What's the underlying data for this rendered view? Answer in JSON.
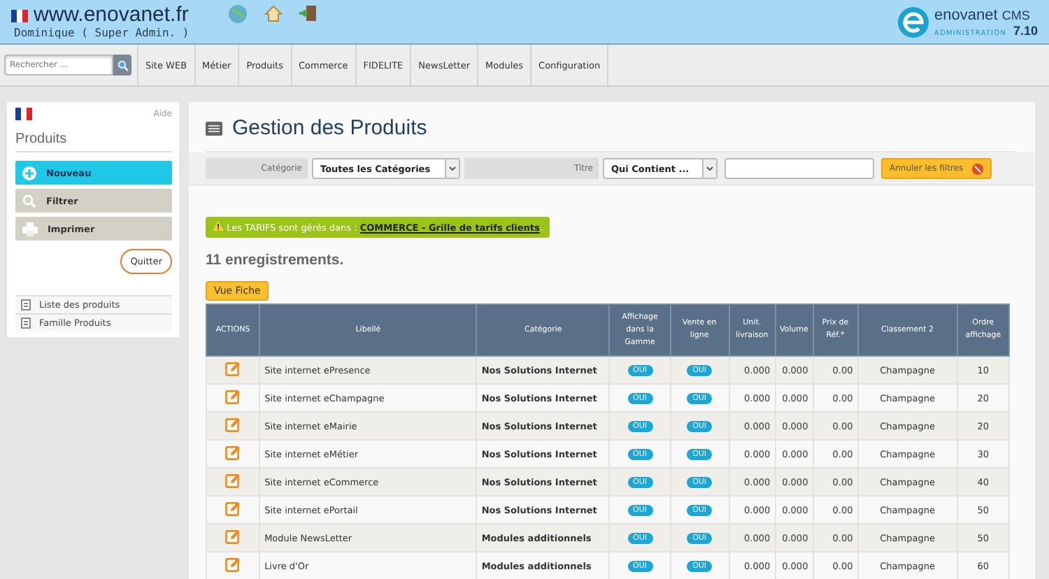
{
  "header": {
    "site": "www.enovanet.fr",
    "user": "Dominique ( Super Admin. )",
    "brand": "enovanet",
    "brand_suffix": "CMS",
    "brand_sub": "ADMINISTRATION",
    "version": "7.10"
  },
  "search": {
    "placeholder": "Rechercher ..."
  },
  "menu": [
    "Site WEB",
    "Métier",
    "Produits",
    "Commerce",
    "FIDELITE",
    "NewsLetter",
    "Modules",
    "Configuration"
  ],
  "sidebar": {
    "help": "Aide",
    "title": "Produits",
    "actions": [
      {
        "label": "Nouveau",
        "kind": "new"
      },
      {
        "label": "Filtrer",
        "kind": "filter"
      },
      {
        "label": "Imprimer",
        "kind": "print"
      }
    ],
    "quit": "Quitter",
    "links": [
      "Liste des produits",
      "Famille Produits"
    ]
  },
  "page": {
    "title": "Gestion des Produits",
    "filters": [
      {
        "label": "Catégorie",
        "value": "Toutes les Catégories"
      },
      {
        "label": "Titre",
        "value": "Qui Contient ..."
      }
    ],
    "reset": "Annuler les filtres",
    "notice": {
      "text": "Les TARIFS sont gérés dans :",
      "link": "COMMERCE - Grille de tarifs clients",
      "end": "."
    },
    "count": "11 enregistrements.",
    "view_button": "Vue Fiche",
    "table": {
      "columns": [
        "ACTIONS",
        "Libellé",
        "Catégorie",
        "Affichage dans la Gamme",
        "Vente en ligne",
        "Unit. livraison",
        "Volume",
        "Prix de Réf.*",
        "Classement 2",
        "Ordre affichage"
      ],
      "rows": [
        {
          "label": "Site internet ePresence",
          "category": "Nos Solutions Internet",
          "display": "OUI",
          "online": "OUI",
          "unit": "0.000",
          "volume": "0.000",
          "price": "0.00",
          "rank": "Champagne",
          "order": "10"
        },
        {
          "label": "Site internet eChampagne",
          "category": "Nos Solutions Internet",
          "display": "OUI",
          "online": "OUI",
          "unit": "0.000",
          "volume": "0.000",
          "price": "0.00",
          "rank": "Champagne",
          "order": "20"
        },
        {
          "label": "Site internet eMairie",
          "category": "Nos Solutions Internet",
          "display": "OUI",
          "online": "OUI",
          "unit": "0.000",
          "volume": "0.000",
          "price": "0.00",
          "rank": "Champagne",
          "order": "20"
        },
        {
          "label": "Site internet eMétier",
          "category": "Nos Solutions Internet",
          "display": "OUI",
          "online": "OUI",
          "unit": "0.000",
          "volume": "0.000",
          "price": "0.00",
          "rank": "Champagne",
          "order": "30"
        },
        {
          "label": "Site internet eCommerce",
          "category": "Nos Solutions Internet",
          "display": "OUI",
          "online": "OUI",
          "unit": "0.000",
          "volume": "0.000",
          "price": "0.00",
          "rank": "Champagne",
          "order": "40"
        },
        {
          "label": "Site internet ePortail",
          "category": "Nos Solutions Internet",
          "display": "OUI",
          "online": "OUI",
          "unit": "0.000",
          "volume": "0.000",
          "price": "0.00",
          "rank": "Champagne",
          "order": "50"
        },
        {
          "label": "Module NewsLetter",
          "category": "Modules additionnels",
          "display": "OUI",
          "online": "OUI",
          "unit": "0.000",
          "volume": "0.000",
          "price": "0.00",
          "rank": "Champagne",
          "order": "50"
        },
        {
          "label": "Livre d'Or",
          "category": "Modules additionnels",
          "display": "OUI",
          "online": "OUI",
          "unit": "0.000",
          "volume": "0.000",
          "price": "0.00",
          "rank": "Champagne",
          "order": "60"
        }
      ]
    }
  }
}
